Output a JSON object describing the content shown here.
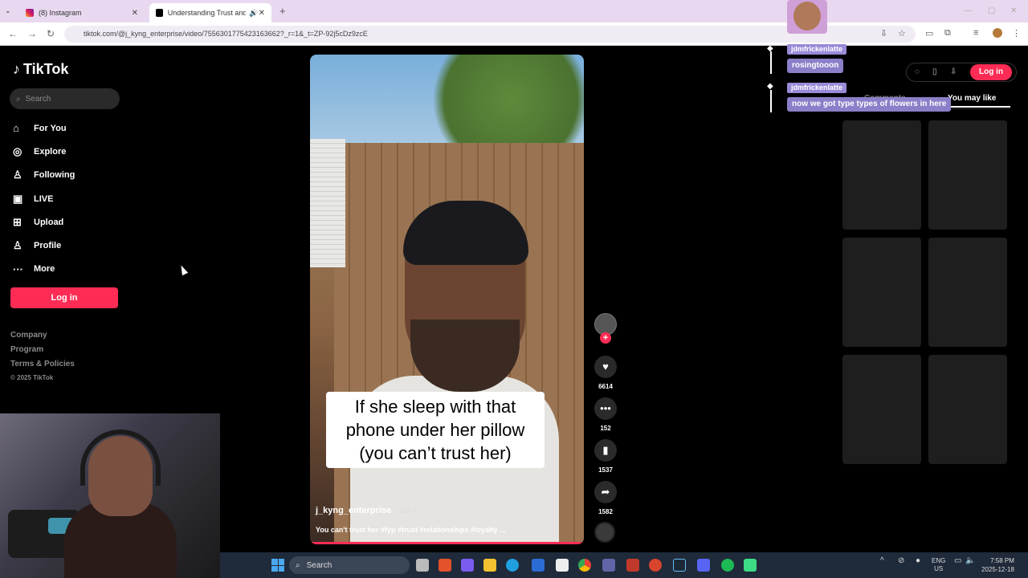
{
  "browser": {
    "tabs": [
      {
        "label": "(8) Instagram",
        "active": false
      },
      {
        "label": "Understanding Trust and Lo",
        "active": true
      }
    ],
    "url": "tiktok.com/@j_kyng_enterprise/video/7556301775423163662?_r=1&_t=ZP-92j5cDz9zcE"
  },
  "sidebar": {
    "brand": "TikTok",
    "search_placeholder": "Search",
    "items": [
      {
        "label": "For You",
        "icon": "home-icon"
      },
      {
        "label": "Explore",
        "icon": "compass-icon"
      },
      {
        "label": "Following",
        "icon": "user-icon"
      },
      {
        "label": "LIVE",
        "icon": "live-icon"
      },
      {
        "label": "Upload",
        "icon": "plus-square-icon"
      },
      {
        "label": "Profile",
        "icon": "profile-icon"
      },
      {
        "label": "More",
        "icon": "more-icon"
      }
    ],
    "login_label": "Log in",
    "footer": [
      "Company",
      "Program",
      "Terms & Policies"
    ],
    "copyright": "© 2025 TikTok"
  },
  "video": {
    "caption": "If she sleep with that phone under her pillow (you can’t trust her)",
    "username": "j_kyng_enterprise",
    "date": " · 10-1",
    "description": "You can't trust her #fyp #trust #relationships #loyalty ..."
  },
  "actions": {
    "likes": "6614",
    "comments": "152",
    "saves": "1537",
    "shares": "1582"
  },
  "right_panel": {
    "login_label": "Log in",
    "tab_comments": "Comments",
    "tab_you_may_like": "You may like"
  },
  "chat": {
    "messages": [
      {
        "user": "jdmfrickenlatte",
        "text": "rosingtooon"
      },
      {
        "user": "jdmfrickenlatte",
        "text": "now we got type types of flowers in here"
      }
    ]
  },
  "taskbar": {
    "search_label": "Search",
    "lang_top": "ENG",
    "lang_bottom": "US",
    "time": "7:58 PM",
    "date": "2025-12-18"
  },
  "colors": {
    "accent": "#fe2c55",
    "background": "#000000",
    "chat_name_bg": "#9b8ad8"
  }
}
